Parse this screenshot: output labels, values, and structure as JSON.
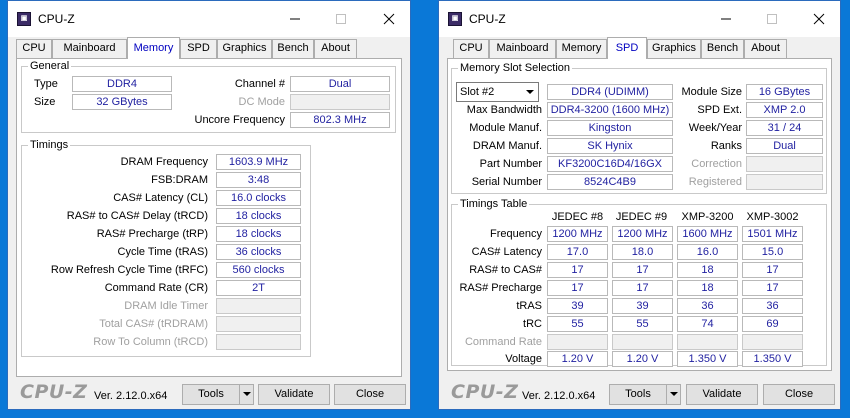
{
  "windows": [
    {
      "title": "CPU-Z",
      "tabs": [
        "CPU",
        "Mainboard",
        "Memory",
        "SPD",
        "Graphics",
        "Bench",
        "About"
      ],
      "active_tab": "Memory",
      "general": {
        "title": "General",
        "type_label": "Type",
        "type_value": "DDR4",
        "size_label": "Size",
        "size_value": "32 GBytes",
        "channel_label": "Channel #",
        "channel_value": "Dual",
        "dcmode_label": "DC Mode",
        "dcmode_value": "",
        "uncore_label": "Uncore Frequency",
        "uncore_value": "802.3 MHz"
      },
      "timings": {
        "title": "Timings",
        "rows": [
          {
            "label": "DRAM Frequency",
            "value": "1603.9 MHz"
          },
          {
            "label": "FSB:DRAM",
            "value": "3:48"
          },
          {
            "label": "CAS# Latency (CL)",
            "value": "16.0 clocks"
          },
          {
            "label": "RAS# to CAS# Delay (tRCD)",
            "value": "18 clocks"
          },
          {
            "label": "RAS# Precharge (tRP)",
            "value": "18 clocks"
          },
          {
            "label": "Cycle Time (tRAS)",
            "value": "36 clocks"
          },
          {
            "label": "Row Refresh Cycle Time (tRFC)",
            "value": "560 clocks"
          },
          {
            "label": "Command Rate (CR)",
            "value": "2T"
          },
          {
            "label": "DRAM Idle Timer",
            "value": ""
          },
          {
            "label": "Total CAS# (tRDRAM)",
            "value": ""
          },
          {
            "label": "Row To Column (tRCD)",
            "value": ""
          }
        ]
      },
      "footer": {
        "logo": "CPU-Z",
        "version": "Ver. 2.12.0.x64",
        "tools": "Tools",
        "validate": "Validate",
        "close": "Close"
      }
    },
    {
      "title": "CPU-Z",
      "tabs": [
        "CPU",
        "Mainboard",
        "Memory",
        "SPD",
        "Graphics",
        "Bench",
        "About"
      ],
      "active_tab": "SPD",
      "slot": {
        "title": "Memory Slot Selection",
        "selected": "Slot #2",
        "type_value": "DDR4 (UDIMM)",
        "module_size_label": "Module Size",
        "module_size_value": "16 GBytes",
        "max_bw_label": "Max Bandwidth",
        "max_bw_value": "DDR4-3200 (1600 MHz)",
        "spd_ext_label": "SPD Ext.",
        "spd_ext_value": "XMP 2.0",
        "manuf_label": "Module Manuf.",
        "manuf_value": "Kingston",
        "week_label": "Week/Year",
        "week_value": "31 / 24",
        "dram_manuf_label": "DRAM Manuf.",
        "dram_manuf_value": "SK Hynix",
        "ranks_label": "Ranks",
        "ranks_value": "Dual",
        "part_label": "Part Number",
        "part_value": "KF3200C16D4/16GX",
        "correction_label": "Correction",
        "correction_value": "",
        "serial_label": "Serial Number",
        "serial_value": "8524C4B9",
        "registered_label": "Registered",
        "registered_value": ""
      },
      "timings_table": {
        "title": "Timings Table",
        "columns": [
          "JEDEC #8",
          "JEDEC #9",
          "XMP-3200",
          "XMP-3002"
        ],
        "rows": [
          {
            "label": "Frequency",
            "values": [
              "1200 MHz",
              "1200 MHz",
              "1600 MHz",
              "1501 MHz"
            ]
          },
          {
            "label": "CAS# Latency",
            "values": [
              "17.0",
              "18.0",
              "16.0",
              "15.0"
            ]
          },
          {
            "label": "RAS# to CAS#",
            "values": [
              "17",
              "17",
              "18",
              "17"
            ]
          },
          {
            "label": "RAS# Precharge",
            "values": [
              "17",
              "17",
              "18",
              "17"
            ]
          },
          {
            "label": "tRAS",
            "values": [
              "39",
              "39",
              "36",
              "36"
            ]
          },
          {
            "label": "tRC",
            "values": [
              "55",
              "55",
              "74",
              "69"
            ]
          },
          {
            "label": "Command Rate",
            "values": [
              "",
              "",
              "",
              ""
            ]
          },
          {
            "label": "Voltage",
            "values": [
              "1.20 V",
              "1.20 V",
              "1.350 V",
              "1.350 V"
            ]
          }
        ]
      },
      "footer": {
        "logo": "CPU-Z",
        "version": "Ver. 2.12.0.x64",
        "tools": "Tools",
        "validate": "Validate",
        "close": "Close"
      }
    }
  ]
}
